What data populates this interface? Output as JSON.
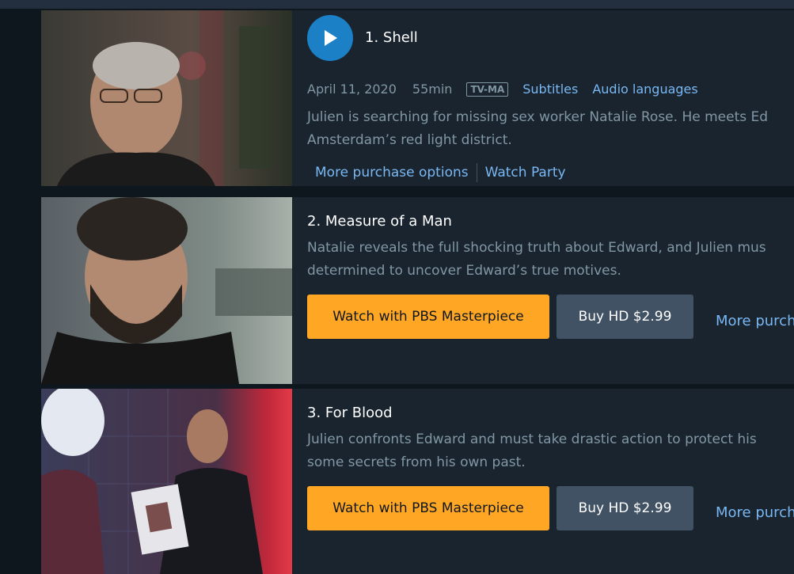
{
  "colors": {
    "background": "#0f171e",
    "card": "#1a242f",
    "accent_link": "#79b8f3",
    "watch_button": "#ffa724",
    "buy_button": "#425265",
    "play_button": "#1c80c6"
  },
  "episodes": [
    {
      "title": "1. Shell",
      "date": "April 11, 2020",
      "duration": "55min",
      "rating": "TV-MA",
      "subtitles_label": "Subtitles",
      "audio_label": "Audio languages",
      "synopsis_line1": "Julien is searching for missing sex worker Natalie Rose. He meets Ed",
      "synopsis_line2": "Amsterdam’s red light district.",
      "more_purchase_label": "More purchase options",
      "watch_party_label": "Watch Party",
      "play_icon": "play-icon"
    },
    {
      "title": "2. Measure of a Man",
      "synopsis_line1": "Natalie reveals the full shocking truth about Edward, and Julien mus",
      "synopsis_line2": "determined to uncover Edward’s true motives.",
      "watch_label": "Watch with PBS Masterpiece",
      "buy_label": "Buy HD $2.99",
      "more_label": "More purch"
    },
    {
      "title": "3. For Blood",
      "synopsis_line1": "Julien confronts Edward and must take drastic action to protect his",
      "synopsis_line2": "some secrets from his own past.",
      "watch_label": "Watch with PBS Masterpiece",
      "buy_label": "Buy HD $2.99",
      "more_label": "More purch"
    }
  ]
}
